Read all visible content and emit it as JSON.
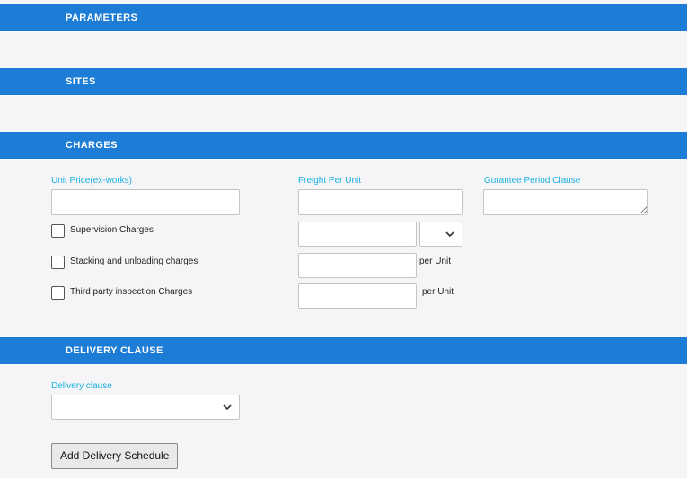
{
  "sections": {
    "parameters": {
      "title": "PARAMETERS"
    },
    "sites": {
      "title": "SITES"
    },
    "charges": {
      "title": "CHARGES"
    },
    "delivery": {
      "title": "DELIVERY CLAUSE"
    }
  },
  "charges": {
    "unit_price": {
      "label": "Unit Price(ex-works)",
      "value": ""
    },
    "freight_per_unit": {
      "label": "Freight Per Unit",
      "value": ""
    },
    "guarantee_period_clause": {
      "label": "Gurantee Period Clause",
      "value": ""
    },
    "supervision": {
      "label": "Supervision Charges",
      "checked": false,
      "value": "",
      "unit_selected": ""
    },
    "stacking": {
      "label": "Stacking and unloading charges",
      "checked": false,
      "value": "",
      "unit_text": "per Unit"
    },
    "third_party": {
      "label": "Third party inspection Charges",
      "checked": false,
      "value": "",
      "unit_text": "per Unit"
    }
  },
  "delivery": {
    "clause": {
      "label": "Delivery clause",
      "selected": ""
    },
    "add_schedule_button": "Add Delivery Schedule"
  },
  "icons": {
    "dropdown": "chevron-down-icon",
    "checkbox": "checkbox-unchecked-icon"
  },
  "colors": {
    "header_bg": "#1c7cd6",
    "header_text": "#ffffff",
    "label_text": "#1ab0e0",
    "page_bg": "#f5f5f7"
  }
}
